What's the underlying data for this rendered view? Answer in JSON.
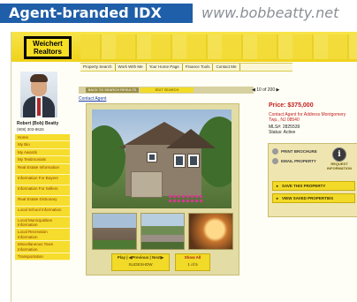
{
  "banner": {
    "title": "Agent-branded IDX",
    "url": "www.bobbeatty.net"
  },
  "logo": {
    "line1": "Weichert",
    "line2": "Realtors"
  },
  "nav": {
    "items": [
      "Property Search",
      "Work With Me",
      "Your Home Page",
      "Finance Tools",
      "Contact Me"
    ]
  },
  "agent": {
    "name": "Robert (Bob) Beatty",
    "phone": "(908) 303-8626"
  },
  "sidebar": {
    "items": [
      "Home",
      "My Bio",
      "My Awards",
      "My Testimonials",
      "Real Estate Information",
      "Information For Buyers",
      "Information For Sellers",
      "Real Estate Dictionary",
      "Local School Information",
      "Local Municipalities Information",
      "Local Recreation Information",
      "Miscellaneous Town Information",
      "Transportation"
    ]
  },
  "toolbar": {
    "back_label": "BACK TO SEARCH RESULTS",
    "edit_label": "EDIT SEARCH",
    "pager_text": "10 of 200",
    "prev_arrow": "◀",
    "next_arrow": "▶"
  },
  "contact_agent_link": "Contact Agent",
  "listing": {
    "price": "Price: $375,000",
    "contact_address": "Contact Agent for Address Montgomery Twp., NJ 08540",
    "mls": "MLS#: 2825539",
    "status": "Status: Active"
  },
  "actions": {
    "print": "PRINT BROCHURE",
    "email": "EMAIL PROPERTY",
    "request_info": "REQUEST INFORMATION",
    "save": "SAVE THIS PROPERTY",
    "view_saved": "VIEW SAVED PROPERTIES"
  },
  "photo_controls": {
    "play_prev_next": "Play | ◀Previous | Next▶",
    "slideshow": "SLIDESHOW",
    "show_all": "Show All",
    "count": "1 of 5"
  },
  "colors": {
    "brand_yellow": "#f2da28",
    "banner_blue": "#1f5ea8",
    "price_red": "#c11d1d"
  }
}
